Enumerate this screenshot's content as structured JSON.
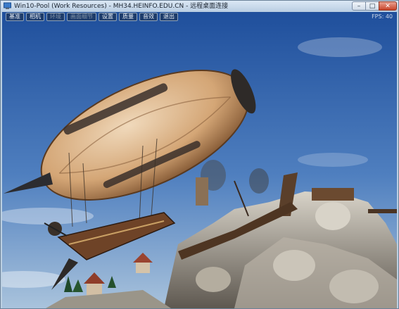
{
  "window": {
    "title": "Win10-Pool (Work Resources) - MH34.HEINFO.EDU.CN - 远程桌面连接",
    "minimize_symbol": "–",
    "maximize_symbol": "□",
    "close_symbol": "✕"
  },
  "toolbar": {
    "items": [
      {
        "label": "基准",
        "enabled": true
      },
      {
        "label": "相机",
        "enabled": true
      },
      {
        "label": "环境",
        "enabled": false
      },
      {
        "label": "画面细节",
        "enabled": false
      },
      {
        "label": "设置",
        "enabled": true
      },
      {
        "label": "质量",
        "enabled": true
      },
      {
        "label": "音效",
        "enabled": true
      },
      {
        "label": "退出",
        "enabled": true
      }
    ]
  },
  "fps": "FPS: 40",
  "colors": {
    "sky_top": "#2f5ea8",
    "sky_bottom": "#9ab9d8",
    "airship_hull": "#d9b892",
    "rock": "#a9a39a"
  }
}
